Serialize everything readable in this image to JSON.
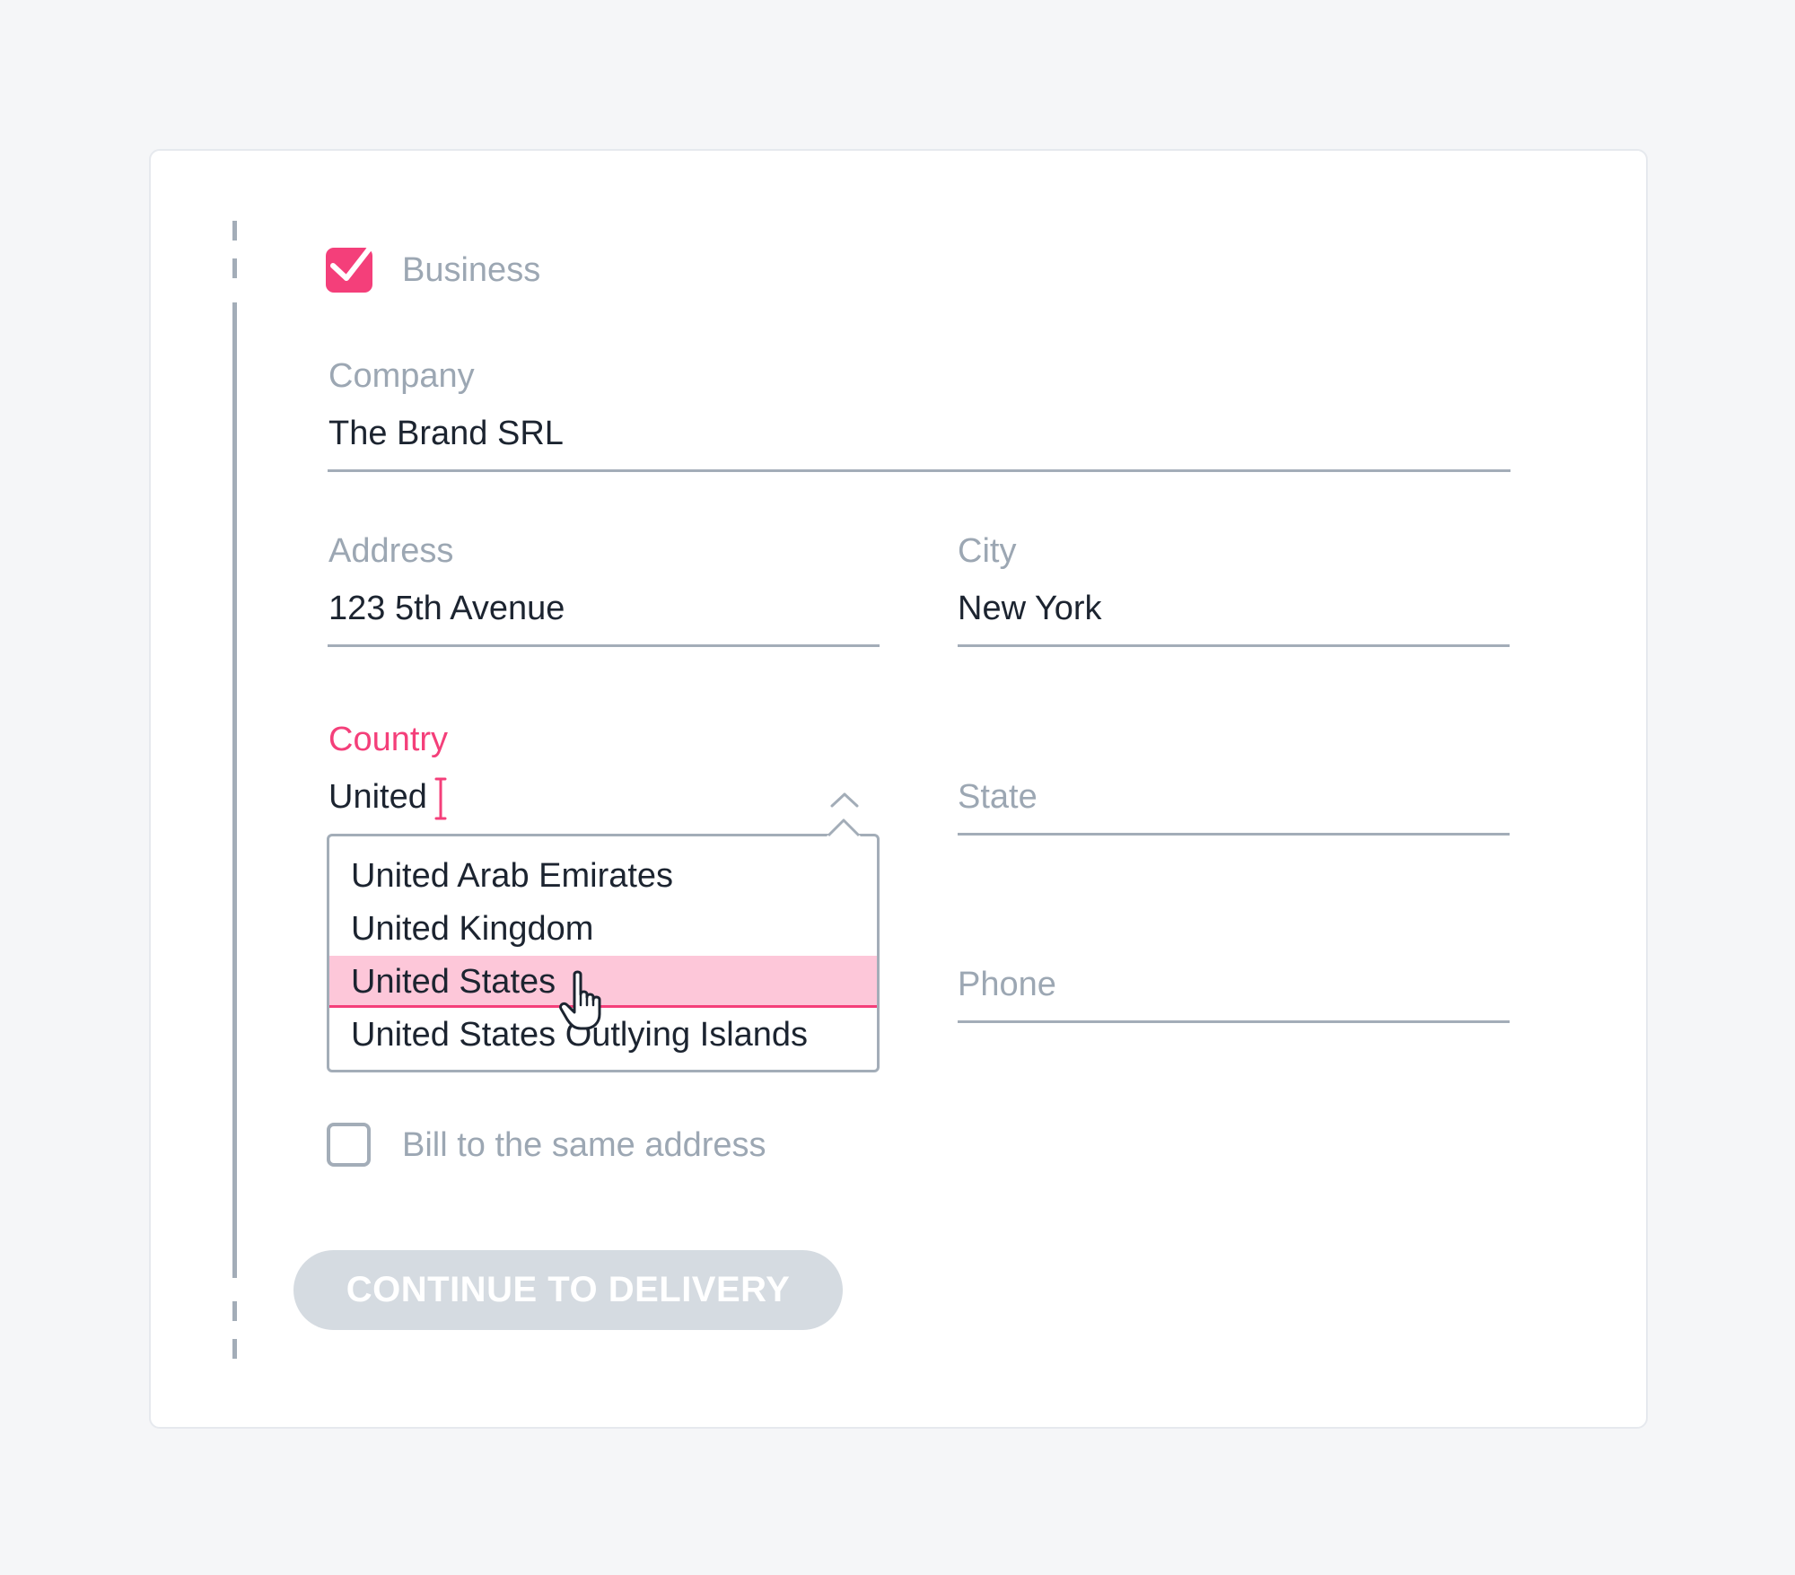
{
  "business": {
    "label": "Business",
    "checked": true
  },
  "company": {
    "label": "Company",
    "value": "The Brand SRL"
  },
  "address": {
    "label": "Address",
    "value": "123 5th Avenue"
  },
  "city": {
    "label": "City",
    "value": "New York"
  },
  "country": {
    "label": "Country",
    "value": "United",
    "options": [
      "United Arab Emirates",
      "United Kingdom",
      "United States",
      "United States Outlying Islands"
    ],
    "highlighted": "United States"
  },
  "state": {
    "placeholder": "State"
  },
  "phone": {
    "placeholder": "Phone"
  },
  "bill_same": {
    "label": "Bill to the same address",
    "checked": false
  },
  "continue_button": {
    "label": "CONTINUE TO DELIVERY",
    "disabled": true
  },
  "colors": {
    "accent": "#f43f7a",
    "highlight": "#fdc7d9",
    "muted": "#9ca7b3",
    "line": "#a3adb8",
    "text": "#1c2430",
    "button_disabled": "#d5dbe1"
  },
  "icons": {
    "checkbox_checked": "check-icon",
    "dropdown_toggle": "chevron-up-icon",
    "text_cursor": "text-cursor-icon",
    "pointer": "hand-pointer-icon"
  }
}
